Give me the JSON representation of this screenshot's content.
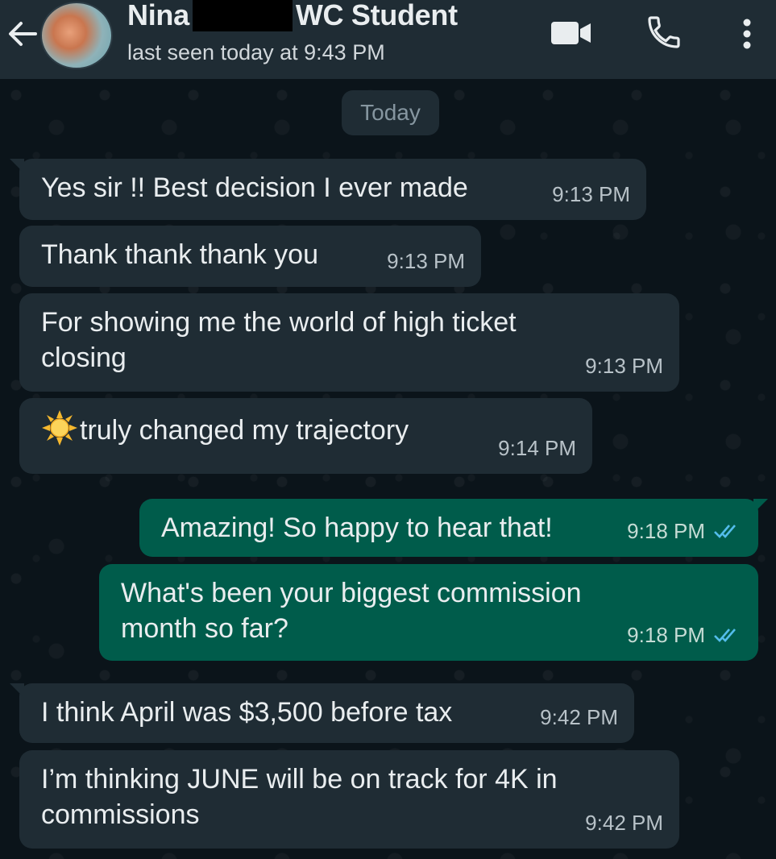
{
  "header": {
    "name_first": "Nina",
    "name_last": "WC Student",
    "status": "last seen today at 9:43 PM",
    "icons": [
      "back-arrow-icon",
      "video-call-icon",
      "phone-icon",
      "more-options-icon"
    ]
  },
  "date_chip": "Today",
  "messages": [
    {
      "direction": "in",
      "text": "Yes sir !! Best decision I ever made",
      "time": "9:13 PM"
    },
    {
      "direction": "in",
      "text": "Thank thank thank you",
      "time": "9:13 PM"
    },
    {
      "direction": "in",
      "text": "For showing me the world of high ticket\nclosing",
      "time": "9:13 PM"
    },
    {
      "direction": "in",
      "emoji": "sun-emoji",
      "text": "truly changed my trajectory",
      "time": "9:14 PM"
    },
    {
      "direction": "out",
      "text": "Amazing! So happy to hear that!",
      "time": "9:18 PM",
      "status": "read"
    },
    {
      "direction": "out",
      "text": "What's been your biggest commission\nmonth so far?",
      "time": "9:18 PM",
      "status": "read"
    },
    {
      "direction": "in",
      "text": "I think April was $3,500 before tax",
      "time": "9:42 PM"
    },
    {
      "direction": "in",
      "text": "I’m thinking JUNE will be on track for 4K in\ncommissions",
      "time": "9:42 PM"
    }
  ],
  "colors": {
    "background": "#0b141a",
    "header": "#1f2c34",
    "incoming_bubble": "#1f2c34",
    "outgoing_bubble": "#005c4b",
    "read_ticks": "#53bdeb"
  }
}
